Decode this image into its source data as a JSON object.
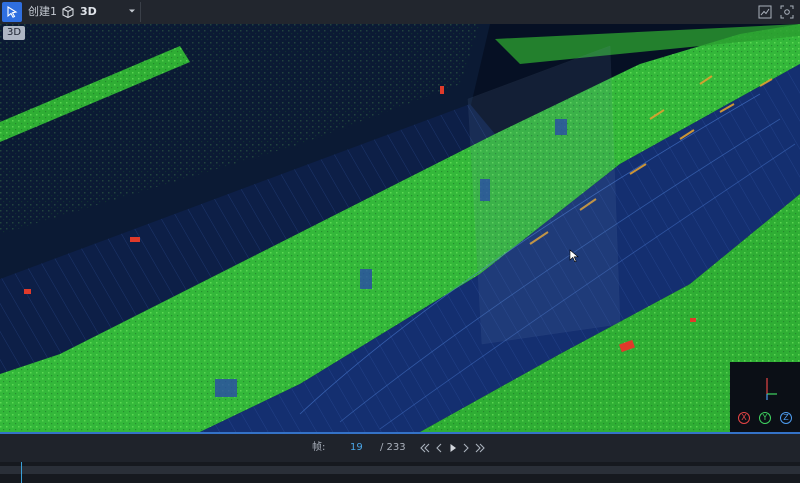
{
  "toolbar": {
    "create_label": "创建",
    "create_count": "1",
    "view_select": "3D"
  },
  "viewport": {
    "mode_badge": "3D",
    "axes": {
      "x": "X",
      "y": "Y",
      "z": "Z"
    }
  },
  "playback": {
    "frame_label": "帧:",
    "current_frame": "19",
    "total_frames": "/ 233"
  },
  "colors": {
    "accent": "#2f6fe0",
    "ground_green": "#36c23a",
    "road_blue": "#1c3f86",
    "frame_highlight": "#4aa5e6"
  },
  "icons": {
    "select": "cursor-arrow-icon",
    "cube": "cube-icon",
    "chart": "chart-icon",
    "fit": "fit-view-icon"
  }
}
